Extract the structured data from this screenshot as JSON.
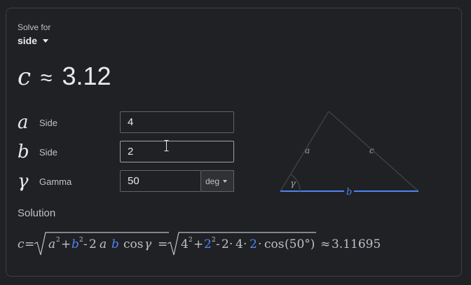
{
  "solve": {
    "label": "Solve for",
    "value": "side"
  },
  "result": {
    "variable": "c",
    "approx": "≈",
    "value": "3.12"
  },
  "inputs": [
    {
      "symbol": "a",
      "label": "Side",
      "value": "4"
    },
    {
      "symbol": "b",
      "label": "Side",
      "value": "2"
    },
    {
      "symbol": "γ",
      "label": "Gamma",
      "value": "50",
      "unit": "deg"
    }
  ],
  "solution": {
    "title": "Solution",
    "lhs": "c",
    "eq": "=",
    "approx_result": "3.11695",
    "general": {
      "a": "a",
      "b": "b",
      "two": "2",
      "cos": "cos",
      "gamma": "γ",
      "exp": "2"
    },
    "numeric": {
      "a": "4",
      "b": "2",
      "two": "2",
      "cos": "cos",
      "angle": "(50°)",
      "exp": "2"
    }
  },
  "diagram": {
    "side_a": "a",
    "side_b": "b",
    "side_c": "c",
    "angle": "γ"
  },
  "colors": {
    "accent_blue": "#4d84f0",
    "text": "#e8eaed",
    "muted": "#bdc1c6",
    "border": "#5f6368"
  }
}
